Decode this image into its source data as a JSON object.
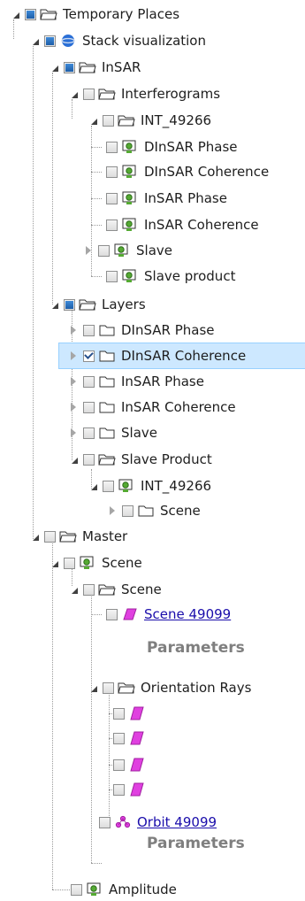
{
  "tree": {
    "temporary_places": "Temporary Places",
    "stack_visualization": "Stack visualization",
    "insar": "InSAR",
    "interferograms": "Interferograms",
    "int_49266": "INT_49266",
    "dinsar_phase": "DInSAR Phase",
    "dinsar_coherence": "DInSAR Coherence",
    "insar_phase": "InSAR Phase",
    "insar_coherence": "InSAR Coherence",
    "slave": "Slave",
    "slave_product": "Slave product",
    "layers": "Layers",
    "layers_dinsar_phase": "DInSAR Phase",
    "layers_dinsar_coherence": "DInSAR Coherence",
    "layers_insar_phase": "InSAR Phase",
    "layers_insar_coherence": "InSAR Coherence",
    "layers_slave": "Slave",
    "layers_slave_product": "Slave Product",
    "layers_int_49266": "INT_49266",
    "layers_scene": "Scene",
    "master": "Master",
    "master_scene": "Scene",
    "master_scene_inner": "Scene",
    "scene_49099": "Scene 49099",
    "parameters_1": "Parameters",
    "orientation_rays": "Orientation Rays",
    "orbit_49099": "Orbit 49099",
    "parameters_2": "Parameters",
    "amplitude": "Amplitude"
  },
  "colors": {
    "selection_bg": "#cde8ff",
    "link": "#1a0dab",
    "parameters_text": "#7f7f7f",
    "polygon_fill": "#e040e0"
  }
}
